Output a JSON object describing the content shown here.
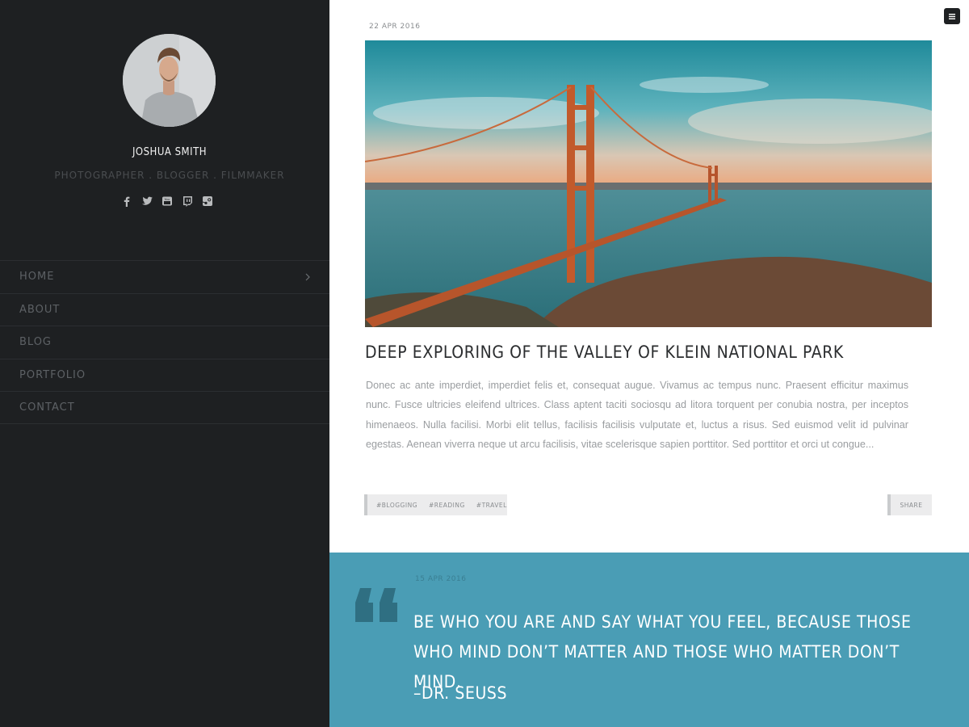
{
  "sidebar": {
    "profile": {
      "name": "JOSHUA SMITH",
      "tagline": "PHOTOGRAPHER . BLOGGER . FILMMAKER"
    },
    "socials": [
      {
        "icon": "facebook-icon"
      },
      {
        "icon": "twitter-icon"
      },
      {
        "icon": "youtube-icon"
      },
      {
        "icon": "twitch-icon"
      },
      {
        "icon": "steam-icon"
      }
    ],
    "nav": [
      {
        "label": "HOME"
      },
      {
        "label": "ABOUT"
      },
      {
        "label": "BLOG"
      },
      {
        "label": "PORTFOLIO"
      },
      {
        "label": "CONTACT"
      }
    ]
  },
  "menu_button": {
    "icon": "hamburger-menu-icon"
  },
  "post": {
    "date": "22 APR 2016",
    "title": "DEEP EXPLORING OF THE VALLEY OF KLEIN NATIONAL PARK",
    "excerpt": "Donec ac ante imperdiet, imperdiet felis et, consequat augue. Vivamus ac tempus nunc. Praesent efficitur maximus nunc. Fusce ultricies eleifend ultrices. Class aptent taciti sociosqu ad litora torquent per conubia nostra, per inceptos himenaeos. Nulla facilisi. Morbi elit tellus, facilisis facilisis vulputate et, luctus a risus. Sed euismod velit id pulvinar egestas. Aenean viverra neque ut arcu facilisis, vitae scelerisque sapien porttitor. Sed porttitor et orci ut congue...",
    "tags": [
      "#BLOGGING",
      "#READING",
      "#TRAVEL"
    ],
    "share_label": "SHARE"
  },
  "quote": {
    "date": "15 APR 2016",
    "text": "BE WHO YOU ARE AND SAY WHAT YOU FEEL, BECAUSE THOSE WHO MIND DON’T MATTER AND THOSE WHO MATTER DON’T MIND.",
    "author": "–DR. SEUSS"
  },
  "colors": {
    "sidebar_bg": "#1e2022",
    "quote_bg": "#4a9db5",
    "quote_mark": "#2f6f82"
  }
}
